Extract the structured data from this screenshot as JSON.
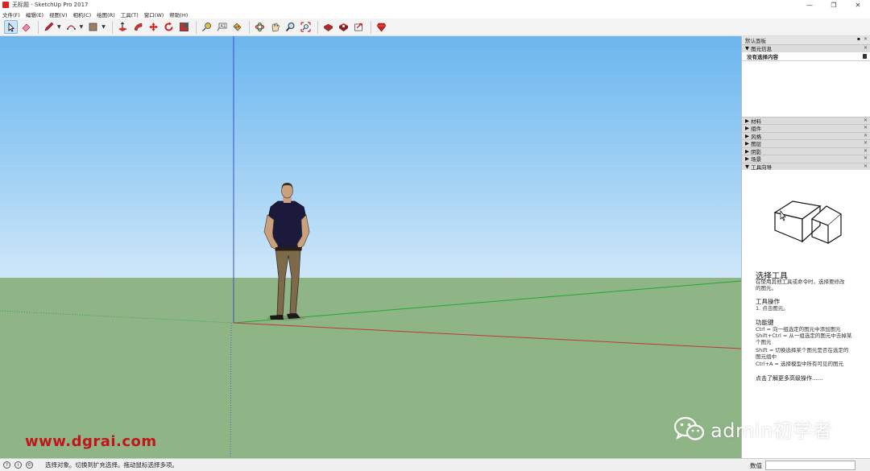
{
  "window": {
    "title": "无标题 - SketchUp Pro 2017",
    "controls": [
      "—",
      "❐",
      "✕"
    ]
  },
  "menu": [
    "文件(F)",
    "编辑(E)",
    "视图(V)",
    "相机(C)",
    "绘图(R)",
    "工具(T)",
    "窗口(W)",
    "帮助(H)"
  ],
  "toolbar": {
    "tools": [
      "select-icon",
      "eraser-icon",
      "pencil-icon",
      "arc-icon",
      "rectangle-icon",
      "push-pull-icon",
      "follow-me-icon",
      "move-icon",
      "rotate-icon",
      "scale-icon",
      "tape-measure-icon",
      "text-icon",
      "paint-bucket-icon",
      "orbit-icon",
      "pan-icon",
      "zoom-icon",
      "zoom-extents-icon",
      "warehouse-icon",
      "extension-warehouse-icon",
      "share-model-icon",
      "ruby-icon"
    ],
    "active": "select-icon"
  },
  "viewport": {
    "watermark_url": "www.dgrai.com",
    "axis_colors": {
      "red": "#c0393a",
      "green": "#1fa83a",
      "blue": "#3a4fc0"
    }
  },
  "panel": {
    "title": "默认面板",
    "entity_info": {
      "header": "图元信息",
      "status": "没有选择内容"
    },
    "trays": [
      "材料",
      "组件",
      "风格",
      "图层",
      "阴影",
      "场景"
    ],
    "instructor": {
      "header": "工具向导",
      "title": "选择工具",
      "desc_line1": "在使用其他工具或命令时，选择要修改",
      "desc_line2": "的图元。",
      "ops_title": "工具操作",
      "ops_line1": "1. 点击图元。",
      "keys_title": "功能键",
      "keys": [
        "Ctrl = 向一组选定的图元中添加图元",
        "Shift+Ctrl = 从一组选定的图元中去掉某",
        "个图元",
        "Shift = 切换选择某个图元是否在选定的",
        "图元组中",
        "Ctrl+A = 选择模型中所有可见的图元"
      ],
      "more": "点击了解更多高级操作......"
    }
  },
  "wechat": {
    "text": "admin初学者"
  },
  "status": {
    "message": "选择对象。切换到扩充选择。拖动鼠标选择多项。",
    "measure_label": "数值",
    "measure_value": ""
  }
}
